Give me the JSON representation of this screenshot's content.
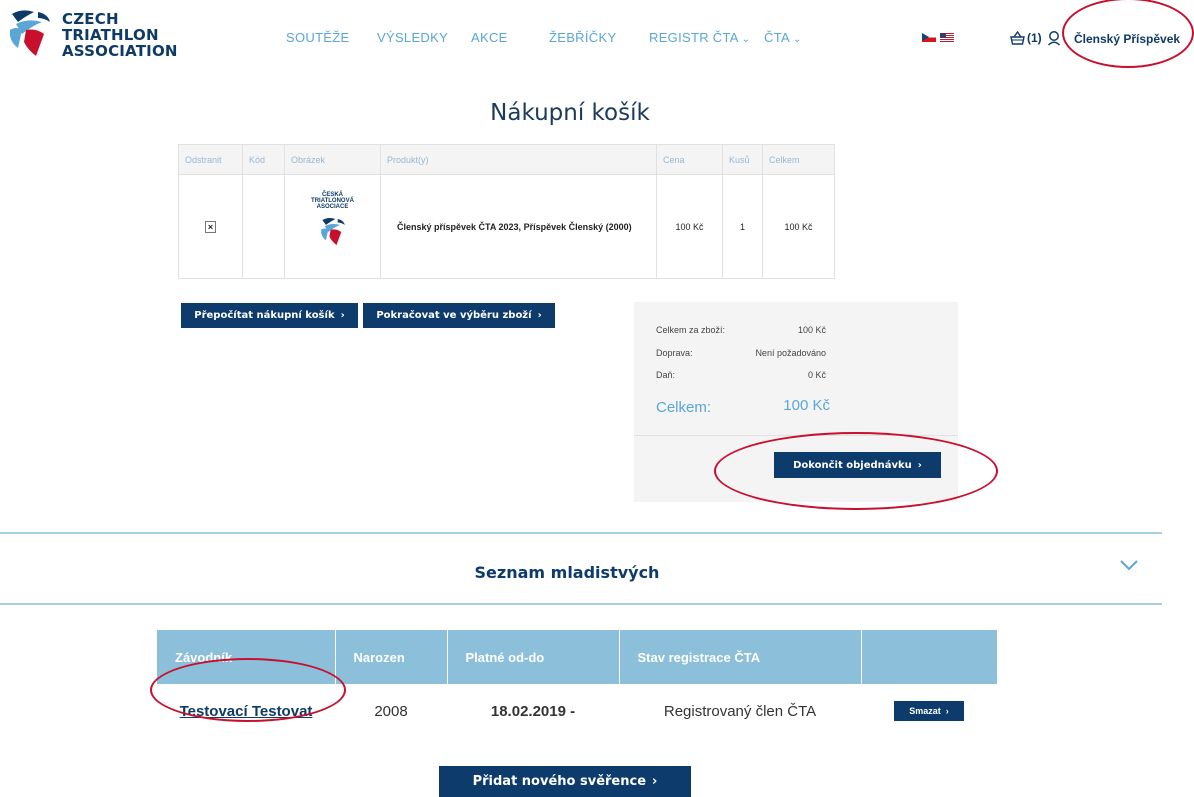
{
  "logo": {
    "lines": [
      "CZECH",
      "TRIATHLON",
      "ASSOCIATION"
    ]
  },
  "nav": {
    "items": [
      {
        "label": "SOUTĚŽE",
        "dropdown": false
      },
      {
        "label": "VÝSLEDKY",
        "dropdown": false
      },
      {
        "label": "AKCE",
        "dropdown": false
      },
      {
        "label": "ŽEBŘÍČKY",
        "dropdown": false
      },
      {
        "label": "REGISTR ČTA",
        "dropdown": true
      },
      {
        "label": "ČTA",
        "dropdown": true
      }
    ]
  },
  "header": {
    "cart_count": "(1)",
    "user_name": "Členský Příspěvek",
    "cart_icon": "cart-icon",
    "user_icon": "user-icon",
    "flags": [
      "cz-flag-icon",
      "us-flag-icon"
    ]
  },
  "cart": {
    "title": "Nákupní košík",
    "columns": [
      "Odstranit",
      "Kód",
      "Obrázek",
      "Produkt(y)",
      "Cena",
      "Kusů",
      "Celkem"
    ],
    "rows": [
      {
        "remove": "×",
        "code": "",
        "image_caption": [
          "ČESKÁ",
          "TRIATLONOVÁ",
          "ASOCIACE"
        ],
        "product": "Členský příspěvek ČTA 2023, Příspěvek Členský (2000)",
        "price": "100 Kč",
        "qty": "1",
        "total": "100 Kč"
      }
    ],
    "recalculate_label": "Přepočítat nákupní košík",
    "continue_label": "Pokračovat ve výběru zboží"
  },
  "summary": {
    "subtotal_label": "Celkem za zboží:",
    "subtotal_value": "100 Kč",
    "shipping_label": "Doprava:",
    "shipping_value": "Není požadováno",
    "tax_label": "Daň:",
    "tax_value": "0 Kč",
    "total_label": "Celkem:",
    "total_value": "100 Kč",
    "checkout_label": "Dokončit objednávku"
  },
  "minors": {
    "title": "Seznam mladistvých",
    "columns": [
      "Závodník",
      "Narozen",
      "Platné od-do",
      "Stav registrace ČTA",
      ""
    ],
    "rows": [
      {
        "name": "Testovací Testovat",
        "born": "2008",
        "valid": "18.02.2019 -",
        "status": "Registrovaný člen ČTA",
        "delete_label": "Smazat"
      }
    ],
    "add_label": "Přidat nového svěřence"
  },
  "colors": {
    "brand_dark": "#0c3b6c",
    "nav_blue": "#5aa6d6",
    "table_header_blue": "#8bbfda",
    "annotation_red": "#c8102e"
  }
}
